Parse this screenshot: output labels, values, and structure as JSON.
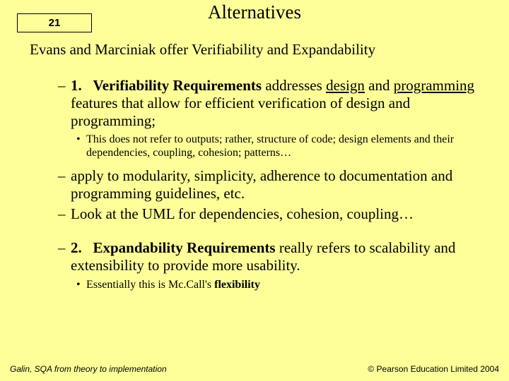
{
  "page_number": "21",
  "title": "Alternatives",
  "lead": "Evans and Marciniak offer Verifiability and Expandability",
  "item1": {
    "num": "1.",
    "head": "Verifiability Requirements",
    "mid1": " addresses ",
    "u1": "design",
    "mid2": " and ",
    "u2": "programming",
    "tail": " features that allow for efficient verification of design and programming;",
    "sub": "This does not refer to outputs; rather, structure of code;  design elements and their dependencies, coupling, cohesion; patterns…"
  },
  "apply": "apply to modularity, simplicity, adherence to documentation and programming guidelines, etc.",
  "uml": "Look at the UML for dependencies, cohesion, coupling…",
  "item2": {
    "num": "2.",
    "head": "Expandability Requirements",
    "tail": " really refers to scalability and extensibility to provide more usability.",
    "sub_pre": "Essentially this is Mc.Call's ",
    "sub_b": "flexibility"
  },
  "footer_left": "Galin, SQA from theory to implementation",
  "footer_right": "© Pearson Education Limited 2004"
}
